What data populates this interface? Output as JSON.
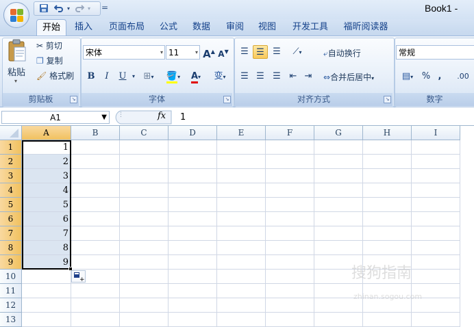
{
  "window": {
    "title": "Book1 -"
  },
  "quick_access": {
    "save_icon": "save-icon",
    "undo_icon": "undo-icon",
    "redo_icon": "redo-icon",
    "customize": "="
  },
  "tabs": [
    {
      "label": "开始",
      "active": true
    },
    {
      "label": "插入"
    },
    {
      "label": "页面布局"
    },
    {
      "label": "公式"
    },
    {
      "label": "数据"
    },
    {
      "label": "审阅"
    },
    {
      "label": "视图"
    },
    {
      "label": "开发工具"
    },
    {
      "label": "福昕阅读器"
    }
  ],
  "ribbon": {
    "clipboard": {
      "label": "剪贴板",
      "paste": "粘贴",
      "cut": "剪切",
      "copy": "复制",
      "format_painter": "格式刷"
    },
    "font": {
      "label": "字体",
      "font_name": "宋体",
      "font_size": "11",
      "grow": "A",
      "shrink": "A",
      "bold": "B",
      "italic": "I",
      "underline": "U",
      "font_color": "A",
      "phonetic": "变"
    },
    "alignment": {
      "label": "对齐方式",
      "wrap_text": "自动换行",
      "merge_center": "合并后居中"
    },
    "number": {
      "label": "数字",
      "format": "常规",
      "percent": "%",
      "comma": ",",
      "increase_decimal": ".00"
    }
  },
  "formula_bar": {
    "name_box": "A1",
    "fx": "fx",
    "value": "1"
  },
  "columns": [
    "A",
    "B",
    "C",
    "D",
    "E",
    "F",
    "G",
    "H",
    "I"
  ],
  "rows": [
    "1",
    "2",
    "3",
    "4",
    "5",
    "6",
    "7",
    "8",
    "9",
    "10",
    "11",
    "12",
    "13"
  ],
  "cells_A": [
    "1",
    "2",
    "3",
    "4",
    "5",
    "6",
    "7",
    "8",
    "9"
  ],
  "watermark": {
    "text": "搜狗指南",
    "url_text": "zhinan.sogou.com"
  }
}
